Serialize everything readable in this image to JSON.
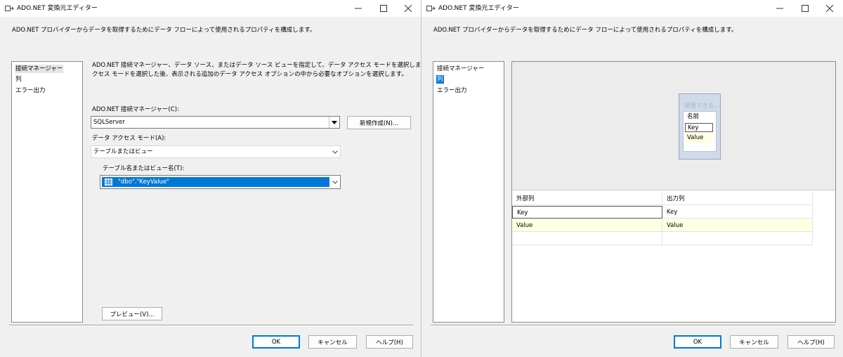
{
  "colors": {
    "accent": "#0078d7",
    "dialog_bg": "#f0f0f0",
    "highlight_row": "#ffffe1"
  },
  "left": {
    "title": "ADO.NET 変換元エディター",
    "description": "ADO.NET プロバイダーからデータを取得するためにデータ フローによって使用されるプロパティを構成します。",
    "nav": [
      "接続マネージャー",
      "列",
      "エラー出力"
    ],
    "intro_line1": "ADO.NET 接続マネージャー、データ ソース、またはデータ ソース ビューを指定して、データ アクセス モードを選択します。データ ア",
    "intro_line2": "クセス モードを選択した後、表示される追加のデータ アクセス オプションの中から必要なオプションを選択します。",
    "conn_label": "ADO.NET 接続マネージャー(C):",
    "conn_value": "SQLServer",
    "new_button": "新規作成(N)...",
    "mode_label": "データ アクセス モード(A):",
    "mode_value": "テーブルまたはビュー",
    "table_label": "テーブル名またはビュー名(T):",
    "table_value": "\"dbo\".\"KeyValue\"",
    "preview_button": "プレビュー(V)...",
    "ok": "OK",
    "cancel": "キャンセル",
    "help": "ヘルプ(H)"
  },
  "right": {
    "title": "ADO.NET 変換元エディター",
    "description": "ADO.NET プロバイダーからデータを取得するためにデータ フローによって使用されるプロパティを構成します。",
    "nav": [
      "接続マネージャー",
      "列",
      "エラー出力"
    ],
    "available_title": "使用できる...",
    "available_columns": [
      "名前",
      "Key",
      "Value"
    ],
    "grid_headers": [
      "外部列",
      "出力列"
    ],
    "grid_rows": [
      [
        "Key",
        "Key"
      ],
      [
        "Value",
        "Value"
      ]
    ],
    "ok": "OK",
    "cancel": "キャンセル",
    "help": "ヘルプ(H)"
  }
}
